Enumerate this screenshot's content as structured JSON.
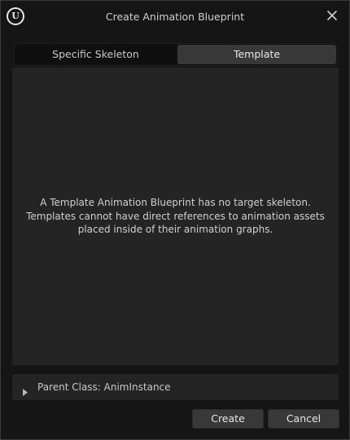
{
  "window": {
    "title": "Create Animation Blueprint",
    "logo_icon": "unreal-engine-logo-icon",
    "close_icon": "close-icon"
  },
  "tabs": [
    {
      "label": "Specific Skeleton",
      "active": false
    },
    {
      "label": "Template",
      "active": true
    }
  ],
  "content": {
    "message_lines": [
      "A Template Animation Blueprint has no target skeleton.",
      "Templates cannot have direct references to animation assets",
      "placed inside of their animation graphs."
    ]
  },
  "parent_class": {
    "label": "Parent Class: AnimInstance",
    "expander_icon": "triangle-right-icon",
    "expanded": false
  },
  "buttons": {
    "create_label": "Create",
    "cancel_label": "Cancel"
  },
  "colors": {
    "background": "#151515",
    "panel": "#242424",
    "tab_active": "#383838",
    "button": "#383838",
    "text": "#d0d0d0"
  }
}
